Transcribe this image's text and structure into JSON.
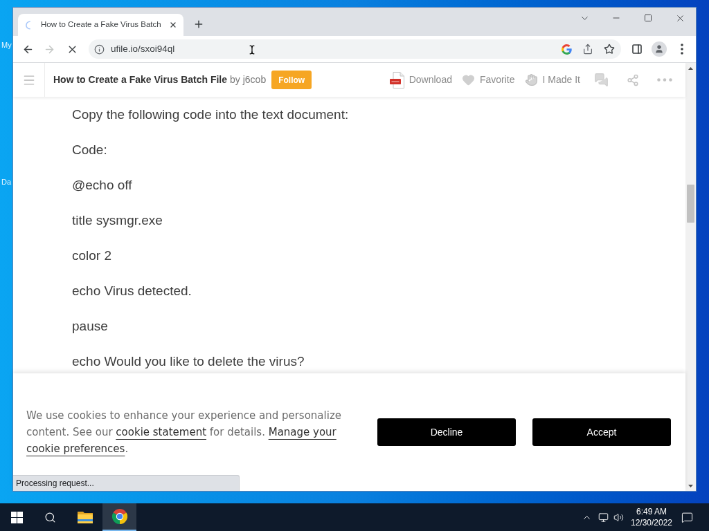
{
  "desktop": {
    "icons": [
      {
        "label": "My"
      },
      {
        "label": "Da"
      }
    ]
  },
  "browser": {
    "tabs": [
      {
        "title": "How to Create a Fake Virus Batch",
        "selected": true,
        "loading": true
      }
    ],
    "back_disabled": false,
    "forward_disabled": true,
    "loading": true,
    "url": "ufile.io/sxoi94ql",
    "status": "Processing request..."
  },
  "page_header": {
    "title": "How to Create a Fake Virus Batch File",
    "byline": "by j6cob",
    "follow": "Follow",
    "actions": [
      {
        "kind": "pdf",
        "label": "Download"
      },
      {
        "kind": "heart",
        "label": "Favorite"
      },
      {
        "kind": "hand",
        "label": "I Made It"
      },
      {
        "kind": "comments"
      },
      {
        "kind": "share"
      },
      {
        "kind": "more"
      }
    ]
  },
  "article": {
    "lines": [
      "Copy the following code into the text document:",
      "Code:",
      "@echo off",
      "title sysmgr.exe",
      "color 2",
      "echo Virus detected.",
      "pause",
      "echo Would you like to delete the virus?"
    ]
  },
  "cookie_banner": {
    "segments": [
      {
        "kind": "text",
        "text": "We use cookies to enhance your experience and personalize content. See our "
      },
      {
        "kind": "link",
        "text": "cookie statement"
      },
      {
        "kind": "text",
        "text": " for details. "
      },
      {
        "kind": "link",
        "text": "Manage your"
      },
      {
        "kind": "link",
        "text": "cookie preferences"
      },
      {
        "kind": "text",
        "text": "."
      }
    ],
    "buttons": [
      "Decline",
      "Accept"
    ]
  },
  "taskbar": {
    "apps": [
      {
        "kind": "explorer",
        "selected": false
      },
      {
        "kind": "chrome",
        "selected": true
      }
    ],
    "time": "6:49 AM",
    "date": "12/30/2022"
  }
}
